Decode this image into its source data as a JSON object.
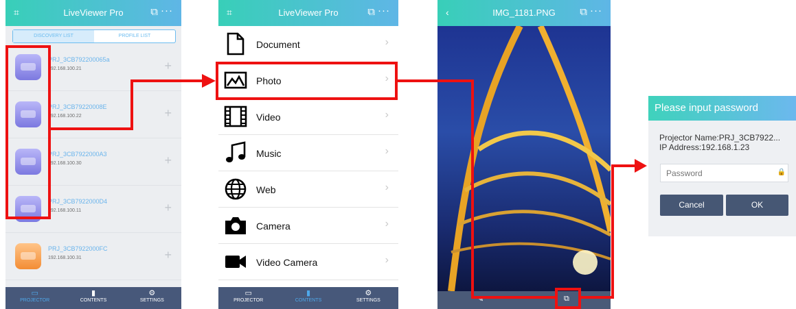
{
  "app_title": "LiveViewer Pro",
  "photo_title": "IMG_1181.PNG",
  "header_icons": {
    "left": "qr-scan-icon",
    "left_back": "back-chevron-icon",
    "cast": "cast-icon",
    "more": "more-dots-icon"
  },
  "segment": {
    "discovery": "DISCOVERY LIST",
    "profile": "PROFILE LIST"
  },
  "projectors": [
    {
      "name": "PRJ_3CB792200065a",
      "ip": "192.168.100.21",
      "color": "blue"
    },
    {
      "name": "PRJ_3CB79220008E",
      "ip": "192.168.100.22",
      "color": "blue"
    },
    {
      "name": "PRJ_3CB7922000A3",
      "ip": "192.168.100.30",
      "color": "blue"
    },
    {
      "name": "PRJ_3CB7922000D4",
      "ip": "192.168.100.11",
      "color": "blue"
    },
    {
      "name": "PRJ_3CB7922000FC",
      "ip": "192.168.100.31",
      "color": "orange"
    }
  ],
  "tabs": {
    "projector": "PROJECTOR",
    "contents": "CONTENTS",
    "settings": "SETTINGS"
  },
  "contents": [
    {
      "label": "Document",
      "icon": "document-icon"
    },
    {
      "label": "Photo",
      "icon": "photo-icon"
    },
    {
      "label": "Video",
      "icon": "film-icon"
    },
    {
      "label": "Music",
      "icon": "music-note-icon"
    },
    {
      "label": "Web",
      "icon": "globe-icon"
    },
    {
      "label": "Camera",
      "icon": "camera-icon"
    },
    {
      "label": "Video Camera",
      "icon": "video-camera-icon"
    }
  ],
  "dialog": {
    "title": "Please input password",
    "projector_name": "Projector Name:PRJ_3CB7922...",
    "ip_address": "IP Address:192.168.1.23",
    "password_placeholder": "Password",
    "cancel": "Cancel",
    "ok": "OK"
  },
  "colors": {
    "accent_blue": "#4fa8ea",
    "highlight_red": "#ee1111",
    "tabbar": "#47587a",
    "header_gradient_start": "#38cfb8",
    "header_gradient_end": "#5fb6e6"
  }
}
